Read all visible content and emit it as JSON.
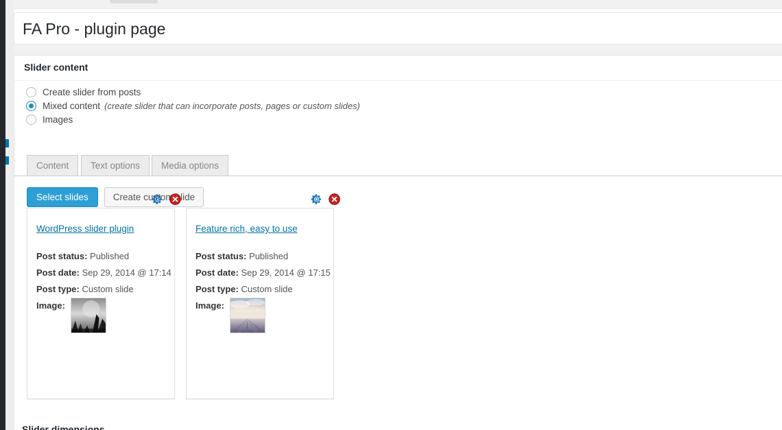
{
  "admin_rail": {
    "accent_color": "#0073aa",
    "dark_color": "#23282d"
  },
  "page_title": "FA Pro - plugin page",
  "panel": {
    "header_title": "Slider content",
    "radio_options": [
      {
        "label": "Create slider from posts",
        "hint": "",
        "checked": false
      },
      {
        "label": "Mixed content",
        "hint": "(create slider that can incorporate posts, pages or custom slides)",
        "checked": true
      },
      {
        "label": "Images",
        "hint": "",
        "checked": false
      }
    ],
    "tabs": [
      {
        "label": "Content",
        "active": false
      },
      {
        "label": "Text options",
        "active": false
      },
      {
        "label": "Media options",
        "active": false
      }
    ],
    "buttons": {
      "select_slides": "Select slides",
      "create_custom_slide": "Create custom slide"
    },
    "field_labels": {
      "post_status": "Post status:",
      "post_date": "Post date:",
      "post_type": "Post type:",
      "image": "Image:"
    },
    "slides": [
      {
        "title": "WordPress slider plugin",
        "post_status": "Published",
        "post_date": "Sep 29, 2014 @ 17:14",
        "post_type": "Custom slide",
        "thumb_description": "grayscale-crowd-photo",
        "gear_icon": "gear-icon",
        "remove_icon": "remove-icon"
      },
      {
        "title": "Feature rich, easy to use",
        "post_status": "Published",
        "post_date": "Sep 29, 2014 @ 17:15",
        "post_type": "Custom slide",
        "thumb_description": "sky-over-field-photo",
        "gear_icon": "gear-icon",
        "remove_icon": "remove-icon"
      }
    ]
  },
  "bottom_section_heading": "Slider dimensions",
  "colors": {
    "primary_button": "#2d9fd4",
    "link": "#0073aa",
    "radio_accent": "#1e8cbe",
    "gear": "#1e73be",
    "remove": "#cc2222"
  }
}
